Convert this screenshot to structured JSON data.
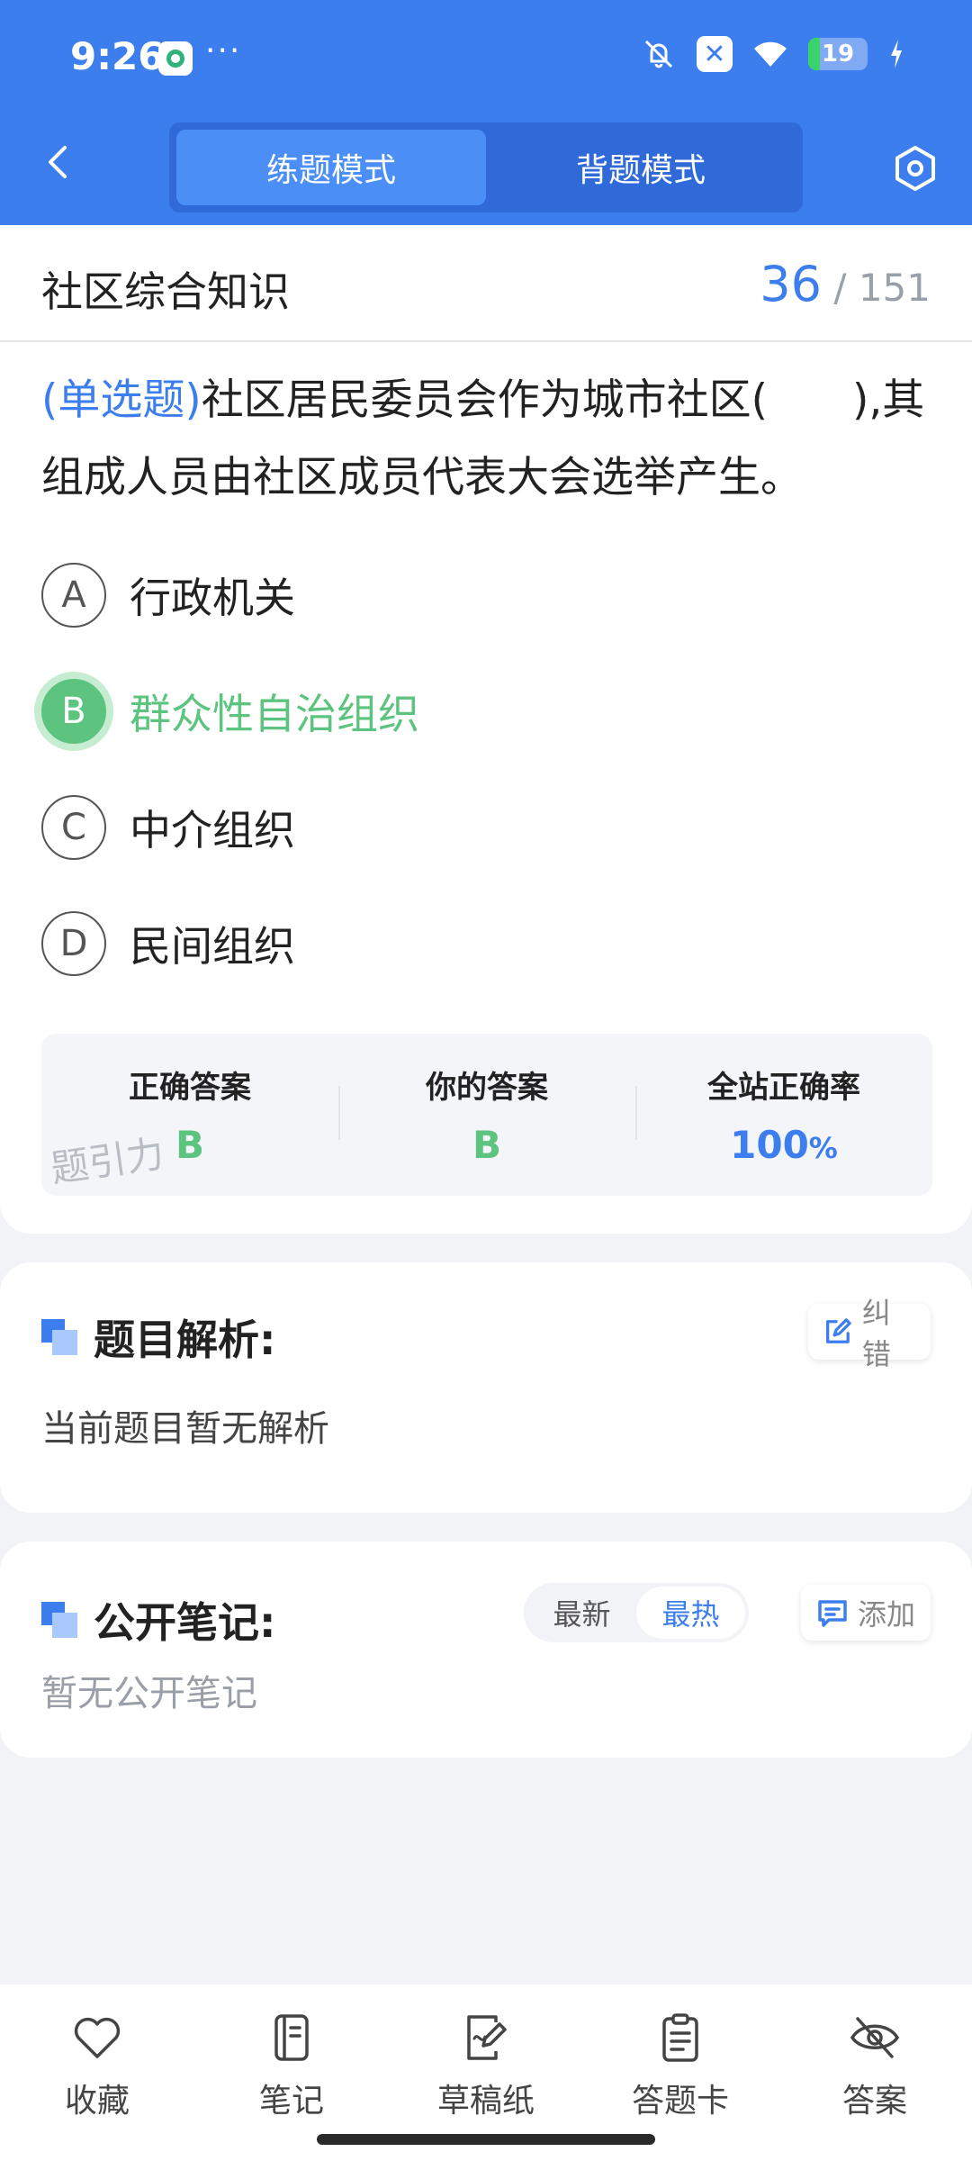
{
  "status_bar": {
    "time": "9:26",
    "dots": "···",
    "battery": "19",
    "battery_level": 0.19
  },
  "header": {
    "modes": [
      "练题模式",
      "背题模式"
    ],
    "active_mode": 0
  },
  "question": {
    "subject": "社区综合知识",
    "current": "36",
    "total": "/ 151",
    "type": "(单选题)",
    "text": "社区居民委员会作为城市社区(　　),其组成人员由社区成员代表大会选举产生。",
    "options": [
      {
        "letter": "A",
        "text": "行政机关"
      },
      {
        "letter": "B",
        "text": "群众性自治组织"
      },
      {
        "letter": "C",
        "text": "中介组织"
      },
      {
        "letter": "D",
        "text": "民间组织"
      }
    ]
  },
  "answer": {
    "correct_label": "正确答案",
    "correct_value": "B",
    "yours_label": "你的答案",
    "yours_value": "B",
    "rate_label": "全站正确率",
    "rate_value": "100",
    "rate_unit": "%",
    "watermark": "题引力"
  },
  "analysis": {
    "title": "题目解析:",
    "report_label": "纠错",
    "body": "当前题目暂无解析"
  },
  "notes": {
    "title": "公开笔记:",
    "tab_latest": "最新",
    "tab_hot": "最热",
    "add_label": "添加",
    "empty": "暂无公开笔记"
  },
  "bottom_nav": [
    "收藏",
    "笔记",
    "草稿纸",
    "答题卡",
    "答案"
  ],
  "colors": {
    "primary": "#3d7eee",
    "correct": "#5cc47f"
  }
}
